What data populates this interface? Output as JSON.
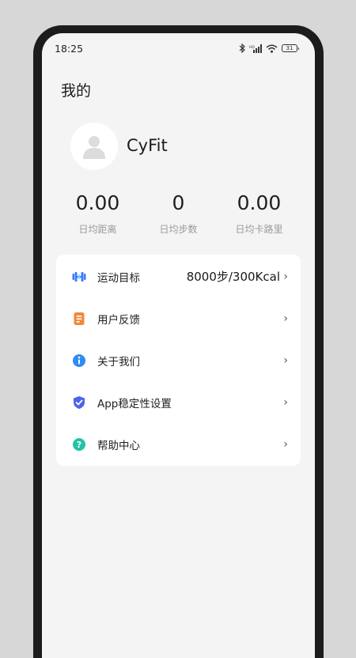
{
  "status_bar": {
    "time": "18:25",
    "battery_level": "31",
    "icons": [
      "bluetooth-icon",
      "signal-icon",
      "wifi-icon",
      "battery-icon"
    ]
  },
  "page": {
    "title": "我的"
  },
  "profile": {
    "username": "CyFit",
    "avatar_icon": "user-placeholder-icon"
  },
  "stats": [
    {
      "value": "0.00",
      "label": "日均距离"
    },
    {
      "value": "0",
      "label": "日均步数"
    },
    {
      "value": "0.00",
      "label": "日均卡路里"
    }
  ],
  "menu": [
    {
      "label": "运动目标",
      "value": "8000步/300Kcal",
      "icon": "dumbbell-icon",
      "color": "#3a7bfd"
    },
    {
      "label": "用户反馈",
      "value": "",
      "icon": "document-icon",
      "color": "#f08a3c"
    },
    {
      "label": "关于我们",
      "value": "",
      "icon": "info-icon",
      "color": "#2f8cf5"
    },
    {
      "label": "App稳定性设置",
      "value": "",
      "icon": "shield-check-icon",
      "color": "#4f63e8"
    },
    {
      "label": "帮助中心",
      "value": "",
      "icon": "help-icon",
      "color": "#22c3a6"
    }
  ]
}
